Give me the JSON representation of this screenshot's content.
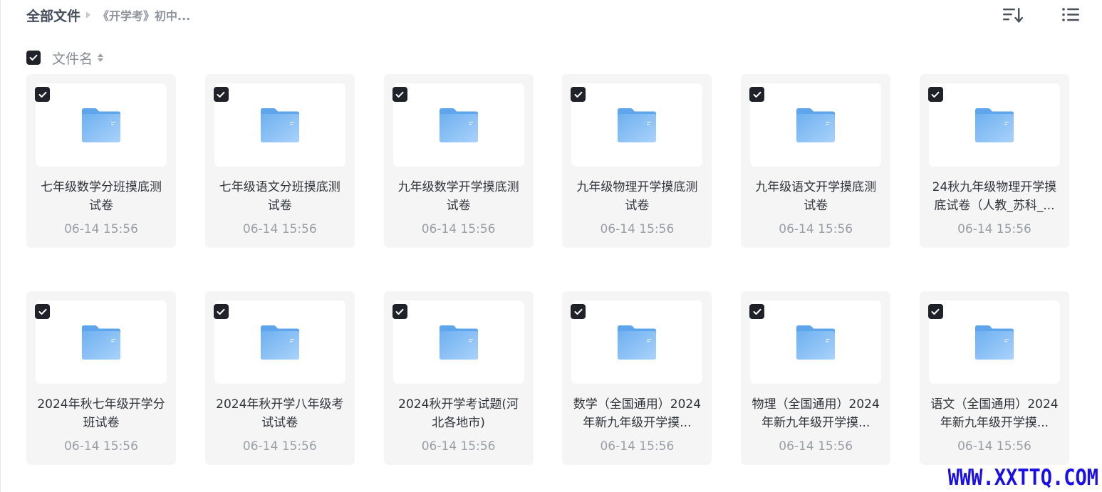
{
  "breadcrumb": {
    "root": "全部文件",
    "current": "《开学考》初中..."
  },
  "toolbar": {
    "sort_icon": "sort-descending-icon",
    "view_icon": "list-view-icon"
  },
  "header": {
    "sort_label": "文件名"
  },
  "files": [
    {
      "name": "七年级数学分班摸底测试卷",
      "date": "06-14 15:56"
    },
    {
      "name": "七年级语文分班摸底测试卷",
      "date": "06-14 15:56"
    },
    {
      "name": "九年级数学开学摸底测试卷",
      "date": "06-14 15:56"
    },
    {
      "name": "九年级物理开学摸底测试卷",
      "date": "06-14 15:56"
    },
    {
      "name": "九年级语文开学摸底测试卷",
      "date": "06-14 15:56"
    },
    {
      "name": "24秋九年级物理开学摸底试卷（人教_苏科_...",
      "date": "06-14 15:56"
    },
    {
      "name": "2024年秋七年级开学分班试卷",
      "date": "06-14 15:56"
    },
    {
      "name": "2024年秋开学八年级考试试卷",
      "date": "06-14 15:56"
    },
    {
      "name": "2024秋开学考试题(河北各地市)",
      "date": "06-14 15:56"
    },
    {
      "name": "数学（全国通用）2024年新九年级开学摸...",
      "date": "06-14 15:56"
    },
    {
      "name": "物理（全国通用）2024年新九年级开学摸...",
      "date": "06-14 15:56"
    },
    {
      "name": "语文（全国通用）2024年新九年级开学摸...",
      "date": "06-14 15:56"
    }
  ],
  "watermark": "WWW.XXTTQ.COM",
  "colors": {
    "folder": "#7ab8f2",
    "check_bg": "#1f2329",
    "watermark": "#1a0fe8"
  }
}
